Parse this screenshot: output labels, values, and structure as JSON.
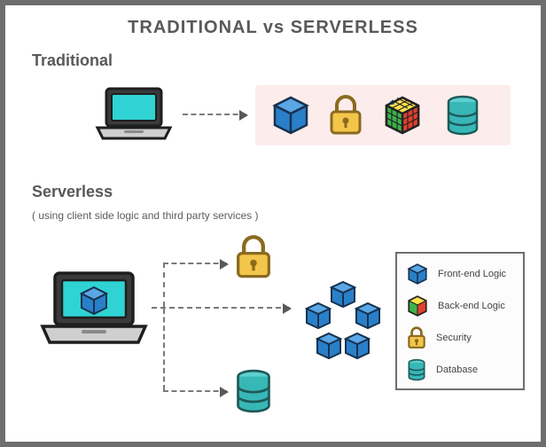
{
  "title": "TRADITIONAL vs SERVERLESS",
  "sections": {
    "traditional": {
      "label": "Traditional"
    },
    "serverless": {
      "label": "Serverless",
      "subtitle": "( using client side logic and third party services )"
    }
  },
  "legend": {
    "frontend": "Front-end Logic",
    "backend": "Back-end Logic",
    "security": "Security",
    "database": "Database"
  },
  "icons": {
    "laptop": "laptop-icon",
    "cube": "cube-icon",
    "lock": "lock-icon",
    "rubik": "rubik-icon",
    "database": "database-icon"
  },
  "colors": {
    "accent_cyan": "#2fd3d3",
    "cube_blue": "#2a7fc9",
    "lock_gold": "#f3c64b",
    "db_teal": "#38b7b7",
    "pink_bg": "#fdecec",
    "frame_gray": "#6e6e6e"
  }
}
